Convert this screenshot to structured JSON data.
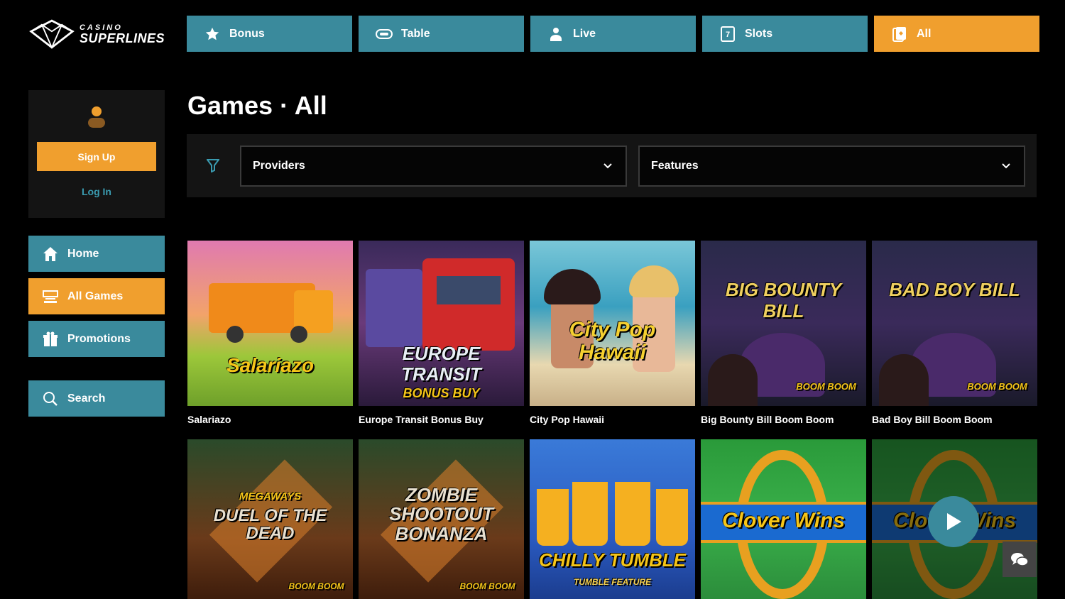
{
  "brand": {
    "small": "CASINO",
    "big": "SUPERLINES"
  },
  "topnav": [
    {
      "label": "Bonus",
      "icon": "star-icon",
      "active": false
    },
    {
      "label": "Table",
      "icon": "chip-icon",
      "active": false
    },
    {
      "label": "Live",
      "icon": "dealer-icon",
      "active": false
    },
    {
      "label": "Slots",
      "icon": "slot-icon",
      "active": false
    },
    {
      "label": "All",
      "icon": "cards-icon",
      "active": true
    }
  ],
  "account": {
    "signup_label": "Sign Up",
    "login_label": "Log In"
  },
  "sidenav": [
    {
      "label": "Home",
      "icon": "home-icon",
      "active": false
    },
    {
      "label": "All Games",
      "icon": "games-icon",
      "active": true
    },
    {
      "label": "Promotions",
      "icon": "gift-icon",
      "active": false
    },
    {
      "label": "Search",
      "icon": "search-icon",
      "active": false
    }
  ],
  "page": {
    "title": "Games · All"
  },
  "filters": {
    "providers_label": "Providers",
    "features_label": "Features"
  },
  "games_row1": [
    {
      "name": "Salariazo",
      "art": "Salariazo"
    },
    {
      "name": "Europe Transit Bonus Buy",
      "art": "EUROPE TRANSIT"
    },
    {
      "name": "City Pop Hawaii",
      "art": "City Pop Hawaii"
    },
    {
      "name": "Big Bounty Bill Boom Boom",
      "art": "BIG BOUNTY BILL"
    },
    {
      "name": "Bad Boy Bill Boom Boom",
      "art": "BAD BOY BILL"
    }
  ],
  "games_row2": [
    {
      "art": "DUEL OF THE DEAD"
    },
    {
      "art": "ZOMBIE SHOOTOUT BONANZA"
    },
    {
      "art": "CHILLY TUMBLE"
    },
    {
      "art": "Clover Wins"
    },
    {
      "art": "Clover Wins"
    }
  ],
  "art_extra": {
    "europe_sub": "BONUS BUY",
    "duel_top": "MEGAWAYS",
    "chilly_sub": "TUMBLE FEATURE",
    "boom": "BOOM BOOM"
  },
  "colors": {
    "accent": "#f09f2e",
    "teal": "#3a8a9c",
    "panel": "#141414"
  }
}
